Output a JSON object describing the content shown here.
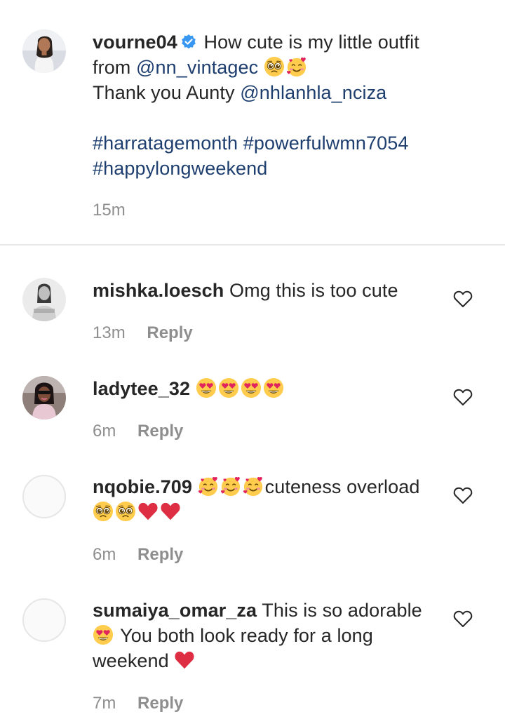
{
  "caption": {
    "username": "vourne04",
    "text_line1": "How cute is my little outfit",
    "from_word": "from",
    "mention1": "@nn_vintagec",
    "line3_prefix": "Thank you Aunty",
    "mention2": "@nhlanhla_nciza",
    "hashtag1": "#harratagemonth",
    "hashtag2": "#powerfulwmn7054",
    "hashtag3": "#happylongweekend",
    "time": "15m"
  },
  "comments": [
    {
      "username": "mishka.loesch",
      "text": "Omg this is too cute",
      "time": "13m",
      "reply_label": "Reply"
    },
    {
      "username": "ladytee_32",
      "text": "",
      "time": "6m",
      "reply_label": "Reply"
    },
    {
      "username": "nqobie.709",
      "text": "cuteness overload",
      "time": "6m",
      "reply_label": "Reply"
    },
    {
      "username": "sumaiya_omar_za",
      "text": "This is so adorable",
      "text2": "You both look ready for a long",
      "text3": "weekend",
      "time": "7m",
      "reply_label": "Reply"
    }
  ],
  "colors": {
    "link": "#1d3e6e",
    "muted": "#8e8e8e",
    "verified": "#3897f0",
    "heart_red": "#e0245e"
  },
  "icons": [
    "verified-badge-icon",
    "heart-outline-icon",
    "pleading-face-emoji",
    "smiling-face-with-hearts-emoji",
    "heart-eyes-emoji",
    "red-heart-emoji"
  ]
}
